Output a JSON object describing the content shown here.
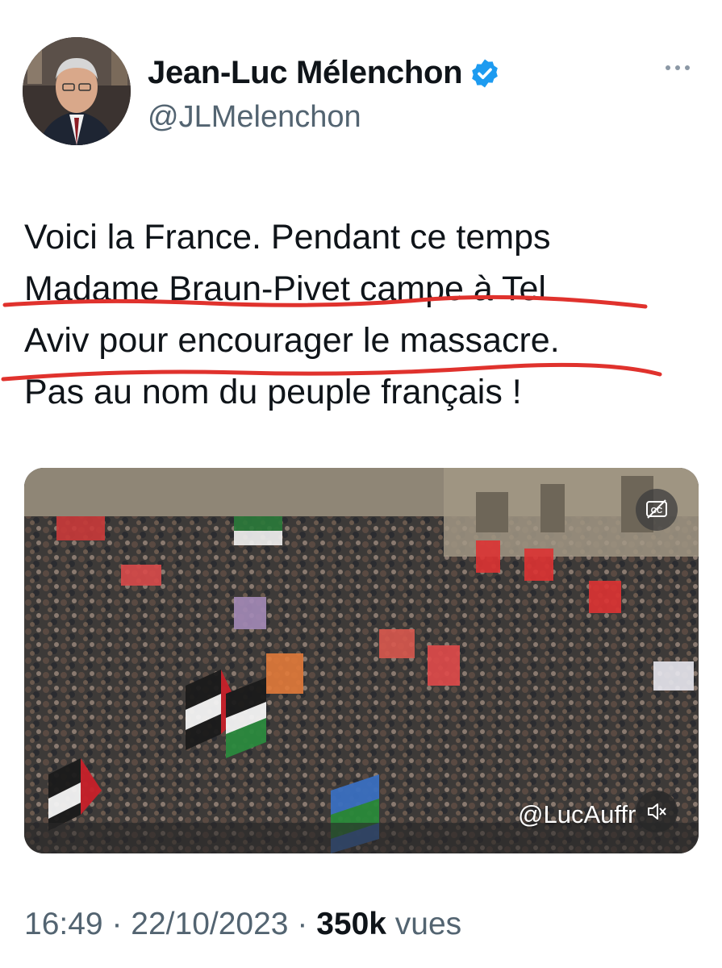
{
  "author": {
    "name": "Jean-Luc Mélenchon",
    "handle": "@JLMelenchon",
    "verified_icon": "verified-badge-icon",
    "verified_color": "#1d9bf0"
  },
  "tweet": {
    "lines": [
      "Voici la France. Pendant ce temps",
      "Madame Braun-Pivet campe à Tel",
      "Aviv pour encourager le massacre.",
      "Pas au nom du peuple français !"
    ],
    "annotation_color": "#e0322d"
  },
  "media": {
    "watermark": "@LucAuffr",
    "cc_icon": "captions-icon",
    "mute_icon": "speaker-muted-icon"
  },
  "meta": {
    "time": "16:49",
    "separator": "·",
    "date": "22/10/2023",
    "views_count": "350k",
    "views_label": "vues"
  },
  "more_icon": "more-options-icon"
}
